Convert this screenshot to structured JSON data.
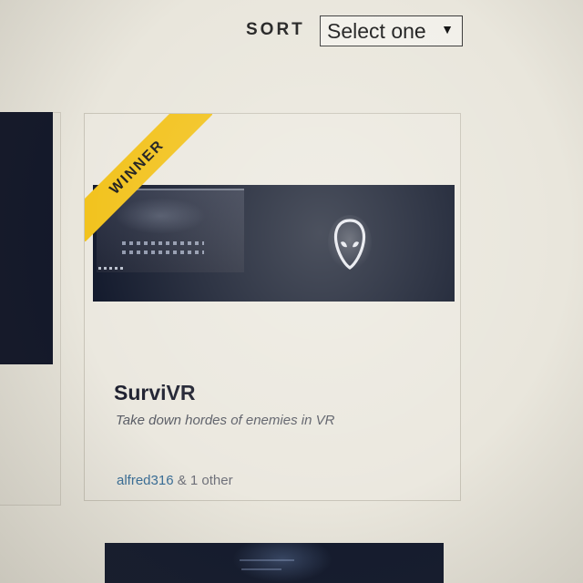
{
  "sort": {
    "label": "SORT",
    "selected": "Select one",
    "arrow_icon": "triangle-down-icon"
  },
  "project": {
    "badge": "WINNER",
    "badge_color": "#f2c21b",
    "title": "SurviVR",
    "tagline": "Take down hordes of enemies in VR",
    "author": "alfred316",
    "others": "& 1 other",
    "author_color": "#3b6f98"
  }
}
